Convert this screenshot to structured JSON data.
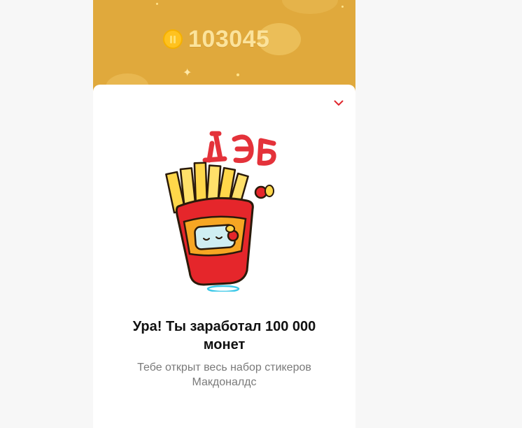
{
  "balance": {
    "coin_icon": "coin-icon",
    "value": "103045"
  },
  "sheet": {
    "collapse_icon": "chevron-down-icon",
    "sticker_icon": "fries-sticker",
    "title": "Ура! Ты заработал 100 000 монет",
    "subtitle": "Тебе открыт весь набор стикеров Макдоналдс"
  },
  "colors": {
    "hero_background": "#e0a93c",
    "coin": "#ffc21f",
    "accent": "#e0282e",
    "page_background": "#f7f7f7"
  }
}
